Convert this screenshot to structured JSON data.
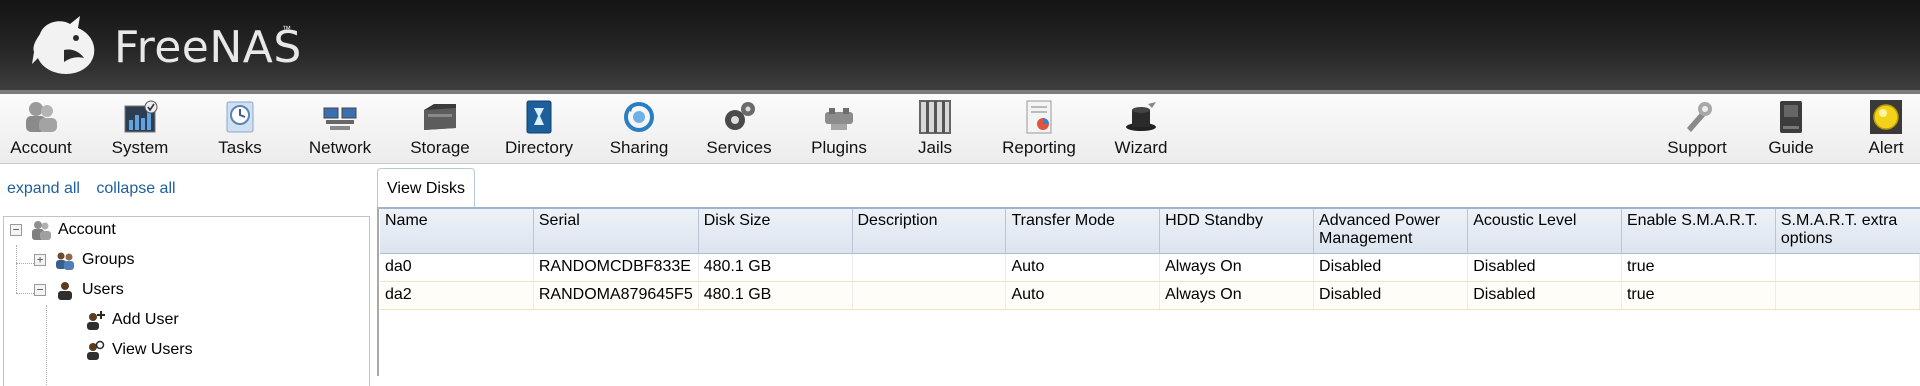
{
  "brand": {
    "name": "FreeNAS",
    "tm": "™"
  },
  "toolbar": {
    "left": [
      {
        "label": "Account",
        "icon": "account-icon"
      },
      {
        "label": "System",
        "icon": "system-icon"
      },
      {
        "label": "Tasks",
        "icon": "tasks-icon"
      },
      {
        "label": "Network",
        "icon": "network-icon"
      },
      {
        "label": "Storage",
        "icon": "storage-icon"
      },
      {
        "label": "Directory",
        "icon": "directory-icon"
      },
      {
        "label": "Sharing",
        "icon": "sharing-icon"
      },
      {
        "label": "Services",
        "icon": "services-icon"
      },
      {
        "label": "Plugins",
        "icon": "plugins-icon"
      },
      {
        "label": "Jails",
        "icon": "jails-icon"
      },
      {
        "label": "Reporting",
        "icon": "reporting-icon"
      },
      {
        "label": "Wizard",
        "icon": "wizard-icon"
      }
    ],
    "right": [
      {
        "label": "Support",
        "icon": "support-icon"
      },
      {
        "label": "Guide",
        "icon": "guide-icon"
      },
      {
        "label": "Alert",
        "icon": "alert-icon"
      }
    ]
  },
  "tree": {
    "expand_all": "expand all",
    "collapse_all": "collapse all",
    "account": "Account",
    "groups": "Groups",
    "users": "Users",
    "add_user": "Add User",
    "view_users": "View Users"
  },
  "tab": {
    "label": "View Disks"
  },
  "table": {
    "columns": [
      "Name",
      "Serial",
      "Disk Size",
      "Description",
      "Transfer Mode",
      "HDD Standby",
      "Advanced Power Management",
      "Acoustic Level",
      "Enable S.M.A.R.T.",
      "S.M.A.R.T. extra options"
    ],
    "rows": [
      [
        "da0",
        "RANDOMCDBF833E",
        "480.1 GB",
        "",
        "Auto",
        "Always On",
        "Disabled",
        "Disabled",
        "true",
        ""
      ],
      [
        "da2",
        "RANDOMA879645F5",
        "480.1 GB",
        "",
        "Auto",
        "Always On",
        "Disabled",
        "Disabled",
        "true",
        ""
      ]
    ]
  },
  "colors": {
    "header_dark": "#1a1a1a",
    "link_blue": "#1f5f9e",
    "grid_header": "#dbe4ef"
  }
}
